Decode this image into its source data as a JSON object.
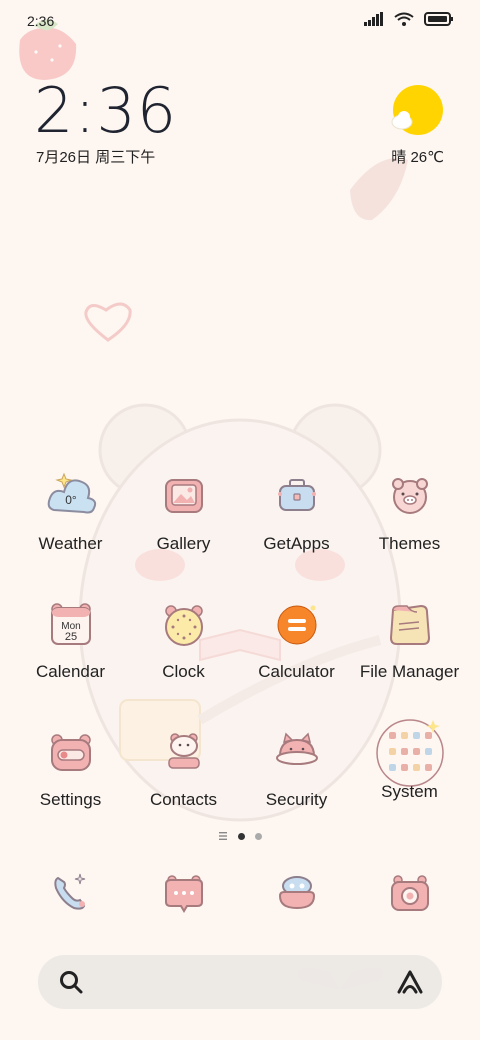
{
  "status_bar": {
    "time": "2:36",
    "icons": [
      "signal-icon",
      "wifi-icon",
      "battery-icon"
    ]
  },
  "clock_widget": {
    "time": "2:36",
    "date": "7月26日 周三下午"
  },
  "weather_widget": {
    "condition_temp": "晴 26℃",
    "icon": "sunny-cloud-icon"
  },
  "apps": [
    {
      "label": "Weather",
      "icon": "weather-icon",
      "badge": "0°"
    },
    {
      "label": "Gallery",
      "icon": "gallery-icon"
    },
    {
      "label": "GetApps",
      "icon": "getapps-icon"
    },
    {
      "label": "Themes",
      "icon": "themes-icon"
    },
    {
      "label": "Calendar",
      "icon": "calendar-icon",
      "badge_day": "Mon",
      "badge_date": "25"
    },
    {
      "label": "Clock",
      "icon": "clock-icon"
    },
    {
      "label": "Calculator",
      "icon": "calculator-icon"
    },
    {
      "label": "File Manager",
      "icon": "file-manager-icon"
    },
    {
      "label": "Settings",
      "icon": "settings-icon"
    },
    {
      "label": "Contacts",
      "icon": "contacts-icon"
    },
    {
      "label": "Security",
      "icon": "security-icon"
    },
    {
      "label": "System",
      "icon": "system-folder-icon"
    }
  ],
  "page_indicator": {
    "pages": 2,
    "current": 1
  },
  "dock": [
    {
      "icon": "phone-icon"
    },
    {
      "icon": "messages-icon"
    },
    {
      "icon": "browser-icon"
    },
    {
      "icon": "camera-icon"
    }
  ],
  "search": {
    "placeholder": ""
  },
  "colors": {
    "background": "#fdf6f1",
    "icon_pink": "#e9a8a8",
    "icon_outline": "#b9868a",
    "sun": "#ffd400",
    "calculator_orange": "#f7862a"
  }
}
